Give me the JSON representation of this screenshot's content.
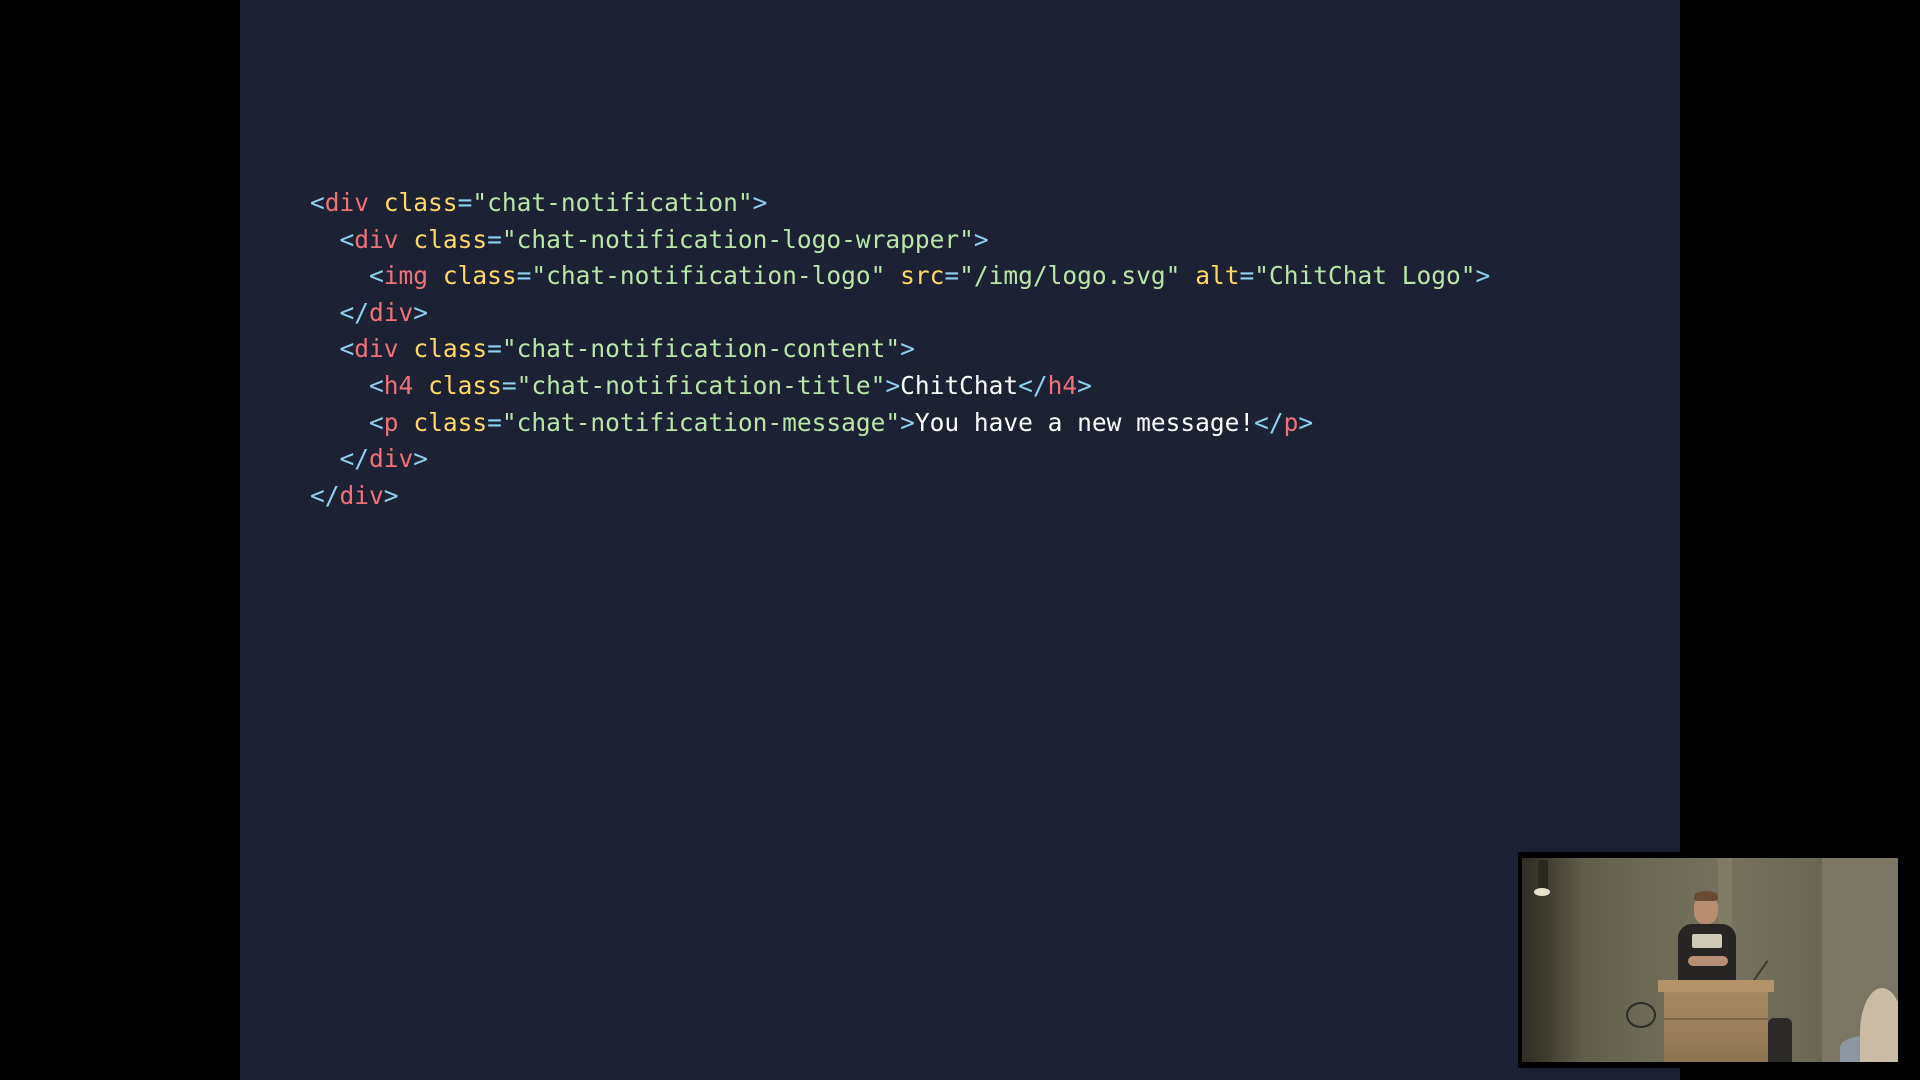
{
  "colors": {
    "page_background": "#000000",
    "slide_background": "#1c2233",
    "punctuation": "#8fd1f0",
    "tag_name": "#f07178",
    "attribute_name": "#ffd866",
    "attribute_value": "#b9e6a8",
    "text_content": "#ffffff"
  },
  "code": {
    "language": "html",
    "lines": [
      {
        "text": "<div class=\"chat-notification\">",
        "tokens": [
          {
            "t": "<",
            "k": "punct"
          },
          {
            "t": "div",
            "k": "tag"
          },
          {
            "t": " ",
            "k": "text"
          },
          {
            "t": "class",
            "k": "attr"
          },
          {
            "t": "=",
            "k": "eq"
          },
          {
            "t": "\"chat-notification\"",
            "k": "str"
          },
          {
            "t": ">",
            "k": "punct"
          }
        ]
      },
      {
        "text": "  <div class=\"chat-notification-logo-wrapper\">",
        "tokens": [
          {
            "t": "  ",
            "k": "text"
          },
          {
            "t": "<",
            "k": "punct"
          },
          {
            "t": "div",
            "k": "tag"
          },
          {
            "t": " ",
            "k": "text"
          },
          {
            "t": "class",
            "k": "attr"
          },
          {
            "t": "=",
            "k": "eq"
          },
          {
            "t": "\"chat-notification-logo-wrapper\"",
            "k": "str"
          },
          {
            "t": ">",
            "k": "punct"
          }
        ]
      },
      {
        "text": "    <img class=\"chat-notification-logo\" src=\"/img/logo.svg\" alt=\"ChitChat Logo\">",
        "tokens": [
          {
            "t": "    ",
            "k": "text"
          },
          {
            "t": "<",
            "k": "punct"
          },
          {
            "t": "img",
            "k": "tag"
          },
          {
            "t": " ",
            "k": "text"
          },
          {
            "t": "class",
            "k": "attr"
          },
          {
            "t": "=",
            "k": "eq"
          },
          {
            "t": "\"chat-notification-logo\"",
            "k": "str"
          },
          {
            "t": " ",
            "k": "text"
          },
          {
            "t": "src",
            "k": "attr"
          },
          {
            "t": "=",
            "k": "eq"
          },
          {
            "t": "\"/img/logo.svg\"",
            "k": "str"
          },
          {
            "t": " ",
            "k": "text"
          },
          {
            "t": "alt",
            "k": "attr"
          },
          {
            "t": "=",
            "k": "eq"
          },
          {
            "t": "\"ChitChat Logo\"",
            "k": "str"
          },
          {
            "t": ">",
            "k": "punct"
          }
        ]
      },
      {
        "text": "  </div>",
        "tokens": [
          {
            "t": "  ",
            "k": "text"
          },
          {
            "t": "</",
            "k": "punct"
          },
          {
            "t": "div",
            "k": "tag"
          },
          {
            "t": ">",
            "k": "punct"
          }
        ]
      },
      {
        "text": "  <div class=\"chat-notification-content\">",
        "tokens": [
          {
            "t": "  ",
            "k": "text"
          },
          {
            "t": "<",
            "k": "punct"
          },
          {
            "t": "div",
            "k": "tag"
          },
          {
            "t": " ",
            "k": "text"
          },
          {
            "t": "class",
            "k": "attr"
          },
          {
            "t": "=",
            "k": "eq"
          },
          {
            "t": "\"chat-notification-content\"",
            "k": "str"
          },
          {
            "t": ">",
            "k": "punct"
          }
        ]
      },
      {
        "text": "    <h4 class=\"chat-notification-title\">ChitChat</h4>",
        "tokens": [
          {
            "t": "    ",
            "k": "text"
          },
          {
            "t": "<",
            "k": "punct"
          },
          {
            "t": "h4",
            "k": "tag"
          },
          {
            "t": " ",
            "k": "text"
          },
          {
            "t": "class",
            "k": "attr"
          },
          {
            "t": "=",
            "k": "eq"
          },
          {
            "t": "\"chat-notification-title\"",
            "k": "str"
          },
          {
            "t": ">",
            "k": "punct"
          },
          {
            "t": "ChitChat",
            "k": "text"
          },
          {
            "t": "</",
            "k": "punct"
          },
          {
            "t": "h4",
            "k": "tag"
          },
          {
            "t": ">",
            "k": "punct"
          }
        ]
      },
      {
        "text": "    <p class=\"chat-notification-message\">You have a new message!</p>",
        "tokens": [
          {
            "t": "    ",
            "k": "text"
          },
          {
            "t": "<",
            "k": "punct"
          },
          {
            "t": "p",
            "k": "tag"
          },
          {
            "t": " ",
            "k": "text"
          },
          {
            "t": "class",
            "k": "attr"
          },
          {
            "t": "=",
            "k": "eq"
          },
          {
            "t": "\"chat-notification-message\"",
            "k": "str"
          },
          {
            "t": ">",
            "k": "punct"
          },
          {
            "t": "You have a new message!",
            "k": "text"
          },
          {
            "t": "</",
            "k": "punct"
          },
          {
            "t": "p",
            "k": "tag"
          },
          {
            "t": ">",
            "k": "punct"
          }
        ]
      },
      {
        "text": "  </div>",
        "tokens": [
          {
            "t": "  ",
            "k": "text"
          },
          {
            "t": "</",
            "k": "punct"
          },
          {
            "t": "div",
            "k": "tag"
          },
          {
            "t": ">",
            "k": "punct"
          }
        ]
      },
      {
        "text": "</div>",
        "tokens": [
          {
            "t": "</",
            "k": "punct"
          },
          {
            "t": "div",
            "k": "tag"
          },
          {
            "t": ">",
            "k": "punct"
          }
        ]
      }
    ]
  },
  "video_overlay": {
    "scene": "speaker-at-podium"
  }
}
